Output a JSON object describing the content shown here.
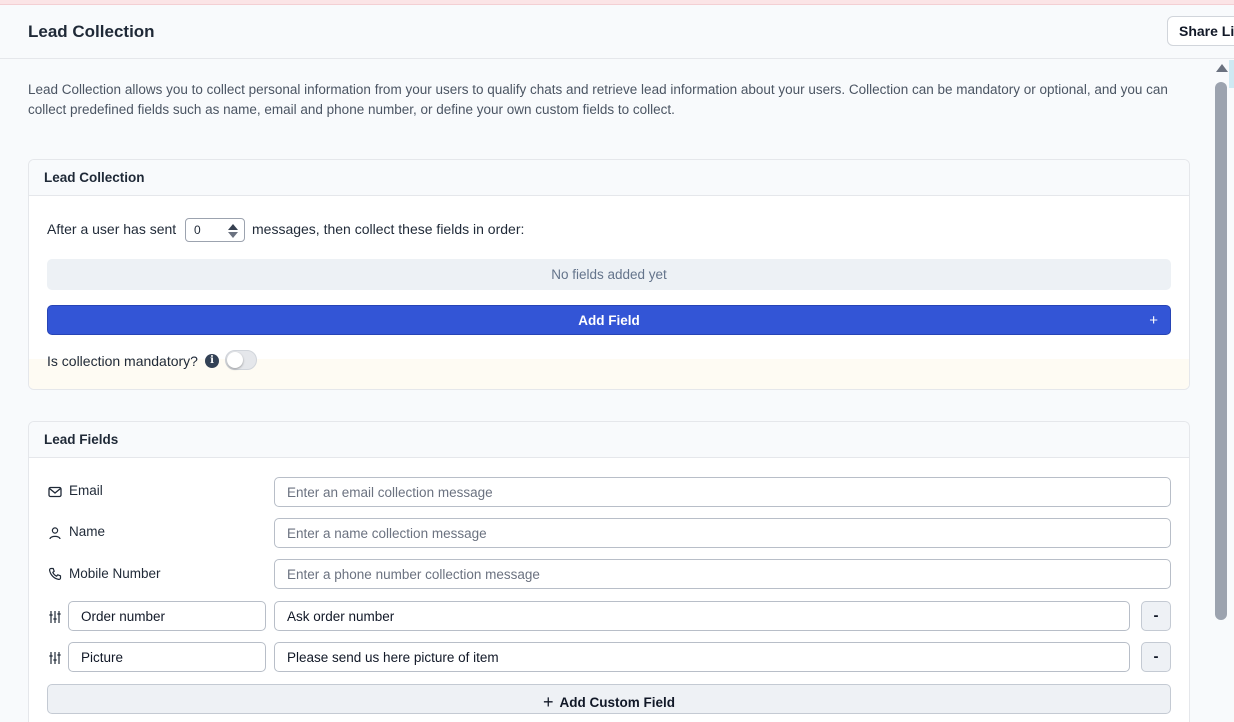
{
  "header": {
    "title": "Lead Collection",
    "share_label": "Share Lin"
  },
  "intro": "Lead Collection allows you to collect personal information from your users to qualify chats and retrieve lead information about your users. Collection can be mandatory or optional, and you can collect predefined fields such as name, email and phone number, or define your own custom fields to collect.",
  "collection": {
    "heading": "Lead Collection",
    "after_prefix": "After a user has sent",
    "messages_value": "0",
    "after_suffix": "messages, then collect these fields in order:",
    "empty_text": "No fields added yet",
    "add_field_label": "Add Field",
    "add_field_icon": "+",
    "mandatory_label": "Is collection mandatory?",
    "mandatory_on": false
  },
  "lead_fields": {
    "heading": "Lead Fields",
    "standard": [
      {
        "label": "Email",
        "icon": "mail-icon",
        "placeholder": "Enter an email collection message"
      },
      {
        "label": "Name",
        "icon": "user-icon",
        "placeholder": "Enter a name collection message"
      },
      {
        "label": "Mobile Number",
        "icon": "phone-icon",
        "placeholder": "Enter a phone number collection message"
      }
    ],
    "custom": [
      {
        "name": "Order number",
        "message": "Ask order number",
        "remove_label": "-"
      },
      {
        "name": "Picture",
        "message": "Please send us here picture of item",
        "remove_label": "-"
      }
    ],
    "add_custom_label": "Add Custom Field",
    "add_custom_icon": "+"
  },
  "colors": {
    "primary": "#3355d6",
    "background": "#f8fafc"
  }
}
